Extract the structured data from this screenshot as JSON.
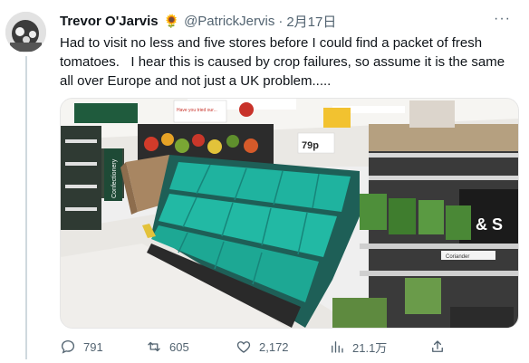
{
  "tweet": {
    "author_name": "Trevor O'Jarvis",
    "author_emoji": "🌻",
    "handle": "@PatrickJervis",
    "separator": "·",
    "date": "2月17日",
    "more_label": "···",
    "text": "Had to visit no less and five stores before I could find a packet of fresh tomatoes.   I hear this is caused by crop failures, so assume it is the same all over Europe and not just a UK problem.....",
    "image": {
      "signs": {
        "aisle_sign": "Confectionery",
        "price_tag": "79p",
        "shelf_label": "Coriander",
        "brand_fragment": "& S",
        "banner_top": "Have you tried our...",
        "tiny_banner": "prices"
      }
    },
    "actions": {
      "replies": "791",
      "retweets": "605",
      "likes": "2,172",
      "views": "21.1万"
    }
  },
  "colors": {
    "text_primary": "#0f1419",
    "text_secondary": "#536471",
    "crate_green": "#1fb39f",
    "floor": "#e9e7e3"
  }
}
